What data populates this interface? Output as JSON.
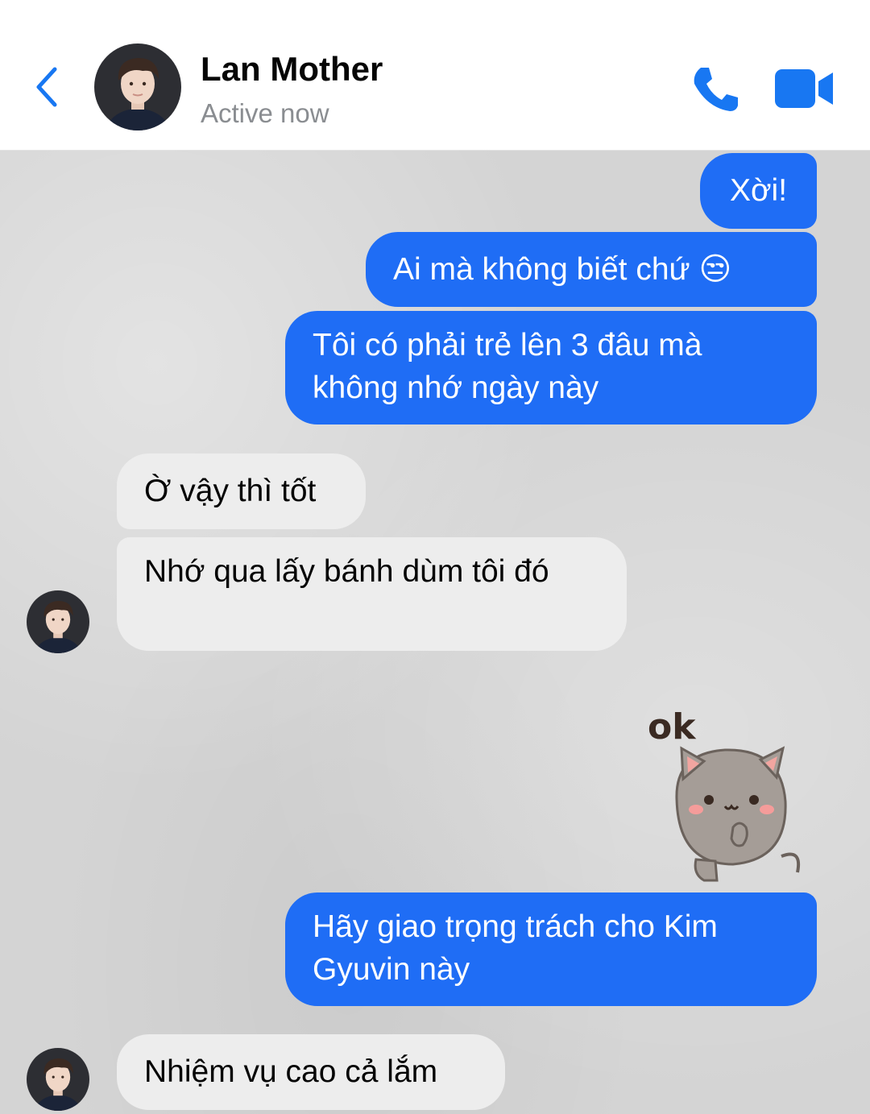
{
  "header": {
    "contact_name": "Lan Mother",
    "status": "Active now",
    "icons": [
      "back-chevron-icon",
      "phone-icon",
      "video-camera-icon"
    ],
    "accent_color": "#1877f2"
  },
  "messages": [
    {
      "side": "outgoing",
      "text": "Xời!"
    },
    {
      "side": "outgoing",
      "text": "Ai mà không biết chứ 😒"
    },
    {
      "side": "outgoing",
      "text": "Tôi có phải trẻ lên 3 đâu mà không nhớ ngày này"
    },
    {
      "side": "incoming",
      "text": "Ờ vậy thì tốt"
    },
    {
      "side": "incoming",
      "text": "Nhớ qua lấy bánh dùm tôi đó"
    },
    {
      "side": "outgoing",
      "type": "sticker",
      "text": "ok"
    },
    {
      "side": "outgoing",
      "text": "Hãy giao trọng trách cho Kim Gyuvin này"
    },
    {
      "side": "incoming",
      "text": "Nhiệm vụ cao cả lắm"
    }
  ],
  "colors": {
    "outgoing_bubble": "#1f6df5",
    "incoming_bubble": "#ededed",
    "chat_background": "#d4d4d4"
  }
}
